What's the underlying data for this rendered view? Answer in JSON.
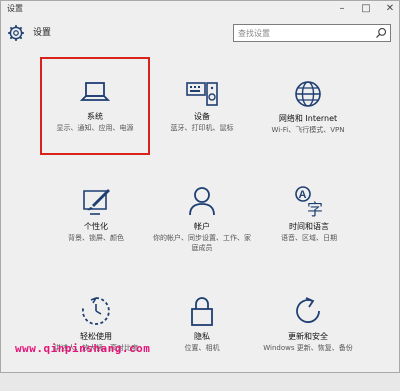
{
  "window": {
    "title": "设置"
  },
  "header": {
    "title": "设置",
    "search_placeholder": "查找设置"
  },
  "tiles": [
    {
      "name": "系统",
      "desc": "显示、通知、应用、电源",
      "icon": "laptop-icon",
      "selected": true
    },
    {
      "name": "设备",
      "desc": "蓝牙、打印机、鼠标",
      "icon": "keyboard-speaker-icon"
    },
    {
      "name": "网络和 Internet",
      "desc": "Wi-Fi、飞行模式、VPN",
      "icon": "globe-icon"
    },
    {
      "name": "个性化",
      "desc": "背景、锁屏、颜色",
      "icon": "paint-screen-icon"
    },
    {
      "name": "帐户",
      "desc": "你的帐户、同步设置、工作、家庭成员",
      "icon": "person-icon"
    },
    {
      "name": "时间和语言",
      "desc": "语音、区域、日期",
      "icon": "language-icon"
    },
    {
      "name": "轻松使用",
      "desc": "讲述人、放大镜、高对比度",
      "icon": "ease-of-access-icon"
    },
    {
      "name": "隐私",
      "desc": "位置、相机",
      "icon": "lock-icon"
    },
    {
      "name": "更新和安全",
      "desc": "Windows 更新、恢复、备份",
      "icon": "refresh-icon"
    }
  ],
  "watermark": "www.qinpinshang.com",
  "colors": {
    "selection_border": "#d9221c",
    "accent": "#1f3f73"
  }
}
